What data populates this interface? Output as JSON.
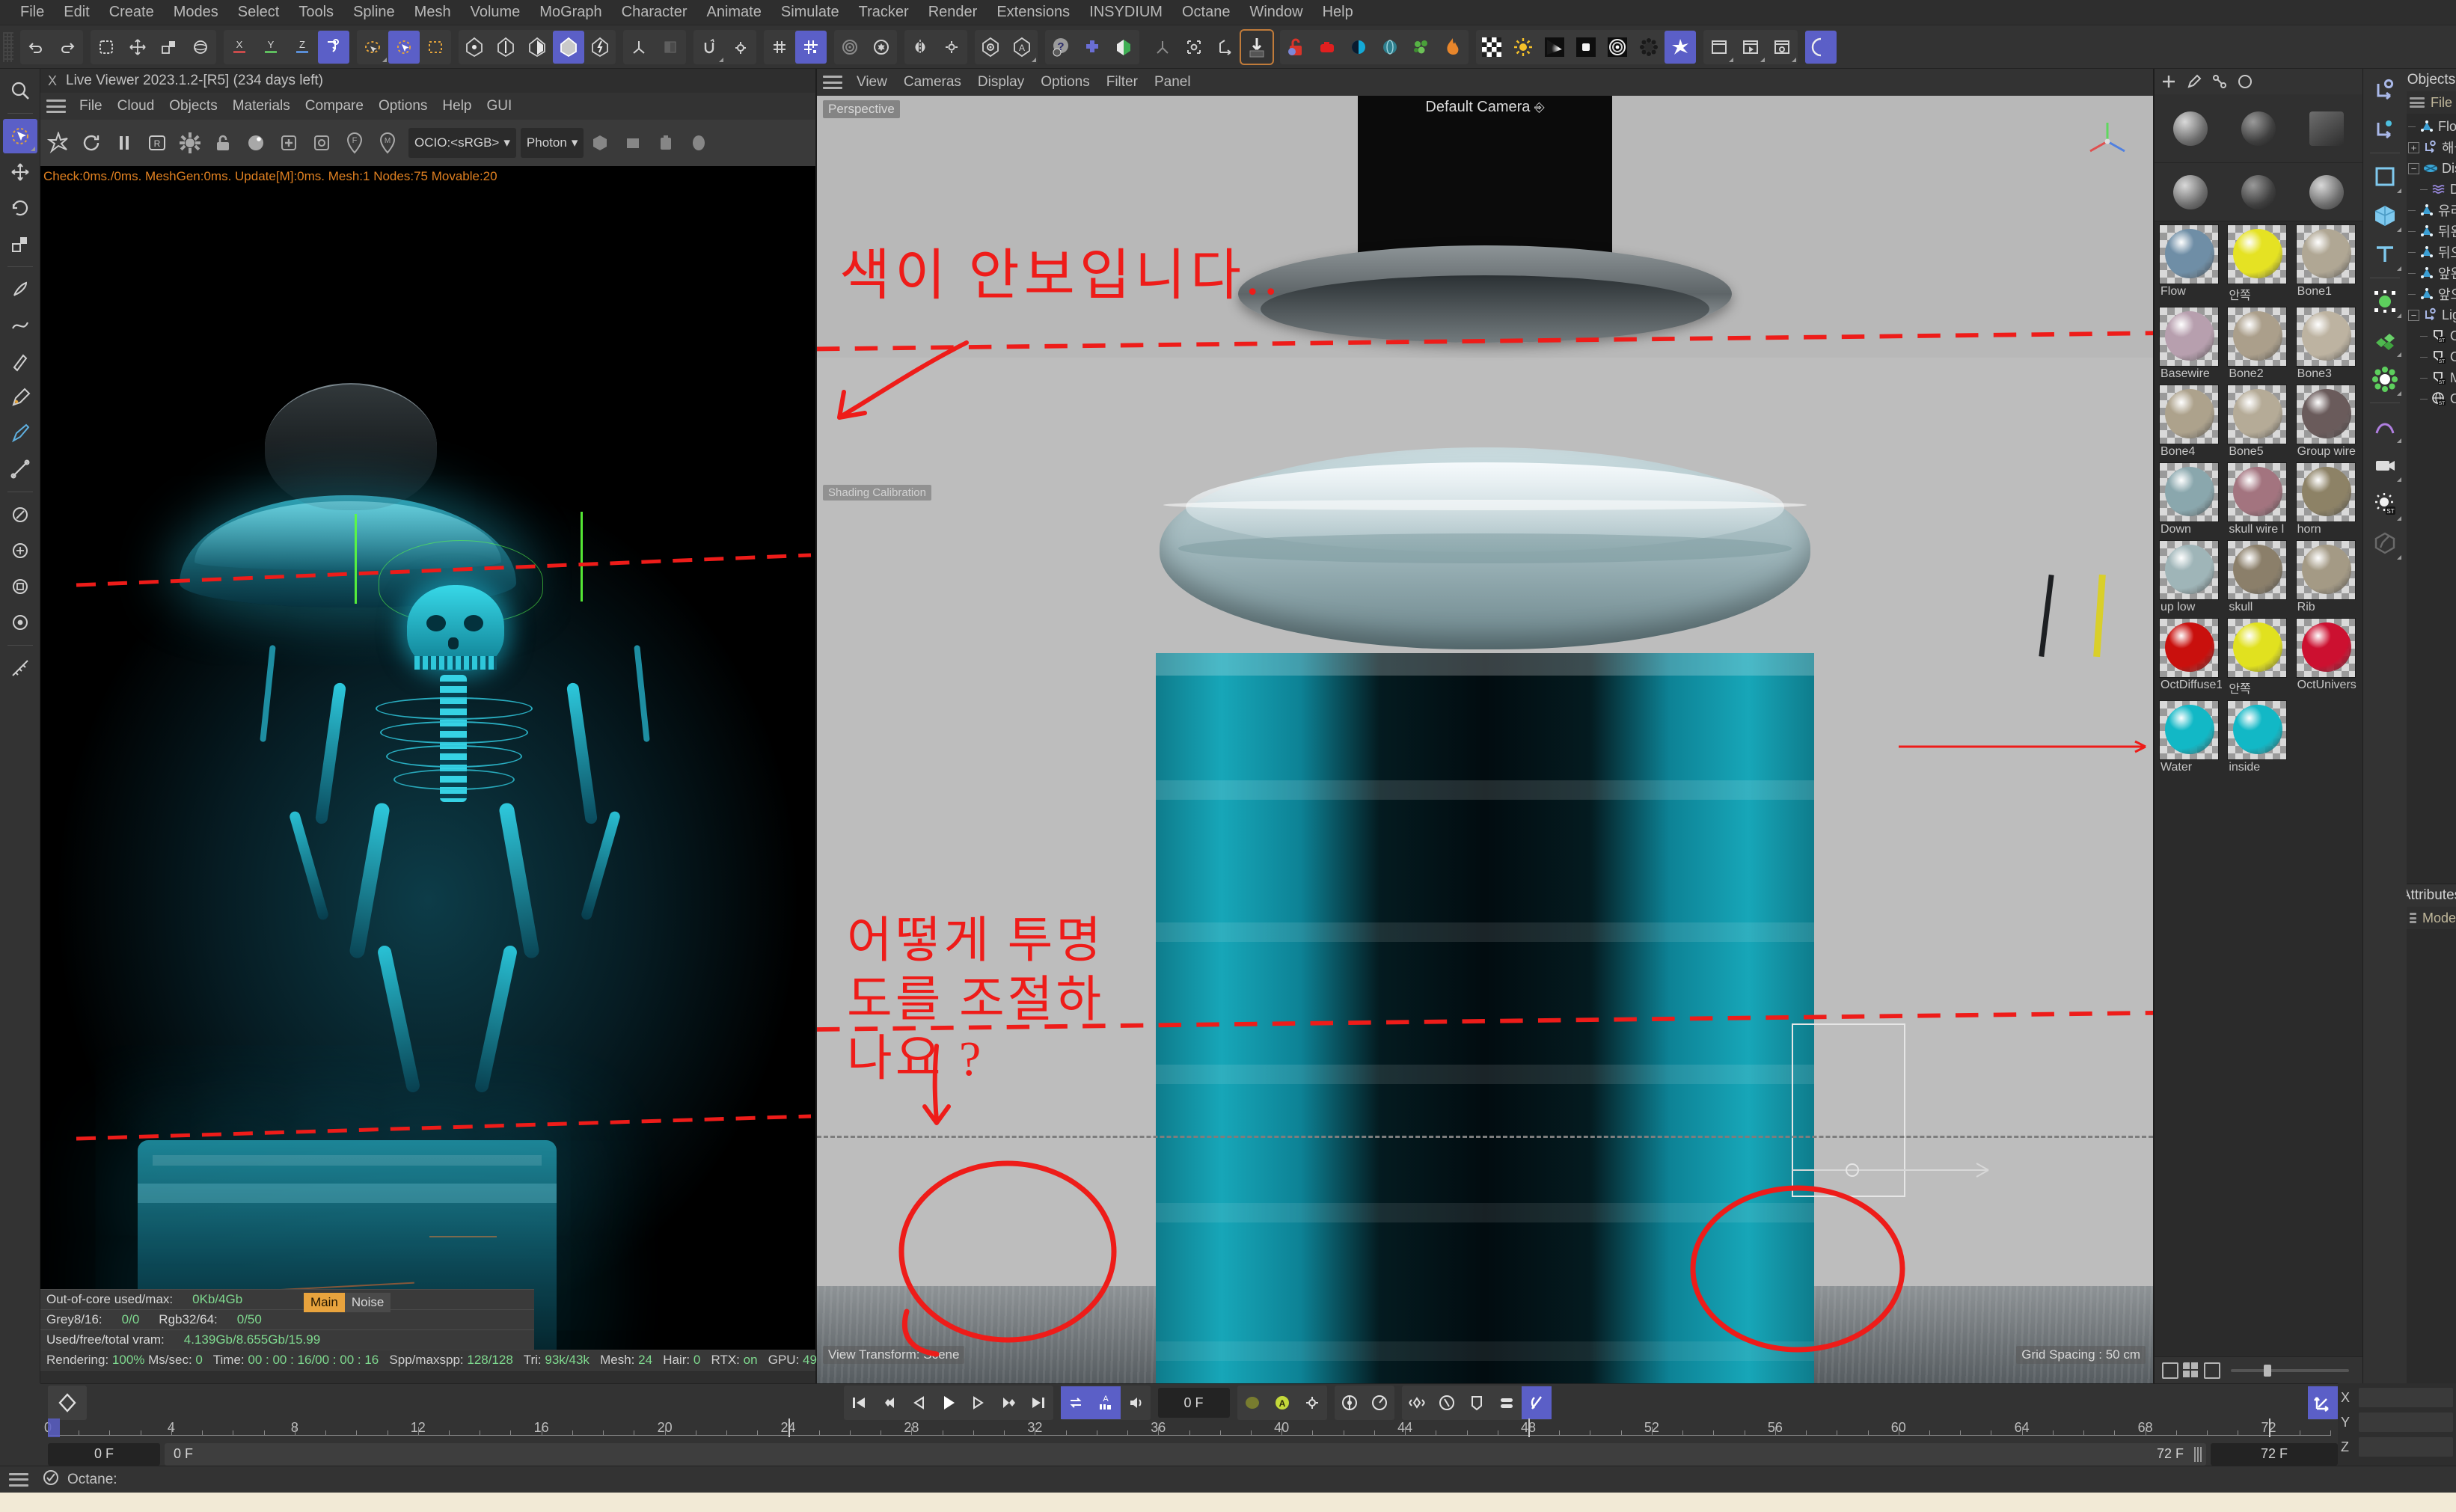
{
  "app": {
    "menu": [
      "File",
      "Edit",
      "Create",
      "Modes",
      "Select",
      "Tools",
      "Spline",
      "Mesh",
      "Volume",
      "MoGraph",
      "Character",
      "Animate",
      "Simulate",
      "Tracker",
      "Render",
      "Extensions",
      "INSYDIUM",
      "Octane",
      "Window",
      "Help"
    ]
  },
  "live_viewer": {
    "title": "Live Viewer 2023.1.2-[R5] (234 days left)",
    "close_label": "X",
    "menu": [
      "File",
      "Cloud",
      "Objects",
      "Materials",
      "Compare",
      "Options",
      "Help",
      "GUI"
    ],
    "ocio_label": "OCIO:<sRGB>",
    "photon_label": "Photon",
    "stats_overlay": "Check:0ms./0ms. MeshGen:0ms. Update[M]:0ms. Mesh:1 Nodes:75 Movable:20",
    "vram": {
      "out_of_core_label": "Out-of-core used/max:",
      "out_of_core_value": "0Kb/4Gb",
      "grey_label": "Grey8/16:",
      "grey_value": "0/0",
      "rgb_label": "Rgb32/64:",
      "rgb_value": "0/50",
      "used_label": "Used/free/total vram:",
      "used_value": "4.139Gb/8.655Gb/15.99"
    },
    "render_tags": {
      "main": "Main",
      "noise": "Noise"
    },
    "render_status": {
      "rendering_label": "Rendering:",
      "rendering_value": "100%",
      "mssec_label": "Ms/sec:",
      "mssec_value": "0",
      "time_label": "Time:",
      "time_value": "00 : 00 : 16/00 : 00 : 16",
      "spp_label": "Spp/maxspp:",
      "spp_value": "128/128",
      "tri_label": "Tri:",
      "tri_value": "93k/43k",
      "mesh_label": "Mesh:",
      "mesh_value": "24",
      "hair_label": "Hair:",
      "hair_value": "0",
      "rtx_label": "RTX:",
      "rtx_value": "on",
      "gpu_label": "GPU:",
      "gpu_value": "49"
    }
  },
  "viewport": {
    "menu": [
      "View",
      "Cameras",
      "Display",
      "Options",
      "Filter",
      "Panel"
    ],
    "perspective_label": "Perspective",
    "camera_title": "Default Camera",
    "bottom_left_label": "View Transform: Scene",
    "bottom_right_label": "Grid Spacing : 50 cm",
    "shader_label": "Shading Calibration",
    "annotations": [
      {
        "name": "color-not-visible-note",
        "text": "색이 안보입니다.."
      },
      {
        "name": "transparency-question-note",
        "text": "어떻게 투명도를 조절하나요 ?"
      }
    ]
  },
  "materials": {
    "items": [
      {
        "label": "Flow",
        "color": "#6f8ea6"
      },
      {
        "label": "안쪽",
        "color": "#e5e223"
      },
      {
        "label": "Bone1",
        "color": "#b0a794"
      },
      {
        "label": "Basewire",
        "color": "#b79fae"
      },
      {
        "label": "Bone2",
        "color": "#ab9f8b"
      },
      {
        "label": "Bone3",
        "color": "#bdb3a1"
      },
      {
        "label": "Bone4",
        "color": "#ada28c"
      },
      {
        "label": "Bone5",
        "color": "#b5ab97"
      },
      {
        "label": "Group wire",
        "color": "#6a5b5b"
      },
      {
        "label": "Down",
        "color": "#8aa7ad"
      },
      {
        "label": "skull wire l",
        "color": "#a3747f"
      },
      {
        "label": "horn",
        "color": "#8d8266"
      },
      {
        "label": "up low",
        "color": "#9fb5b8"
      },
      {
        "label": "skull",
        "color": "#8b7f6a"
      },
      {
        "label": "Rib",
        "color": "#a49a85"
      },
      {
        "label": "OctDiffuse1",
        "color": "#c9100d"
      },
      {
        "label": "안쪽",
        "color": "#e1e11f"
      },
      {
        "label": "OctUnivers",
        "color": "#cc1030"
      },
      {
        "label": "Water",
        "color": "#12b8c6"
      },
      {
        "label": "inside",
        "color": "#12b8c6"
      }
    ]
  },
  "objects_panel": {
    "tab": "Objects",
    "menu": "File",
    "tree": [
      {
        "name": "Flow",
        "icon": "polygon-icon",
        "expander": "none",
        "depth": 0
      },
      {
        "name": "해골",
        "icon": "null-icon",
        "expander": "plus",
        "depth": 0
      },
      {
        "name": "Disc",
        "icon": "disc-icon",
        "expander": "minus",
        "depth": 0
      },
      {
        "name": "D",
        "icon": "wave-icon",
        "expander": "none",
        "depth": 1
      },
      {
        "name": "유리",
        "icon": "polygon-icon",
        "expander": "none",
        "depth": 0
      },
      {
        "name": "뒤왼",
        "icon": "polygon-icon",
        "expander": "none",
        "depth": 0
      },
      {
        "name": "뒤오",
        "icon": "polygon-icon",
        "expander": "none",
        "depth": 0
      },
      {
        "name": "앞왼",
        "icon": "polygon-icon",
        "expander": "none",
        "depth": 0
      },
      {
        "name": "앞오",
        "icon": "polygon-icon",
        "expander": "none",
        "depth": 0
      },
      {
        "name": "Light",
        "icon": "null-icon",
        "expander": "minus",
        "depth": 0
      },
      {
        "name": "O",
        "icon": "arealight-icon",
        "expander": "none",
        "depth": 1
      },
      {
        "name": "O",
        "icon": "arealight-icon",
        "expander": "none",
        "depth": 1
      },
      {
        "name": "M",
        "icon": "arealight-icon",
        "expander": "none",
        "depth": 1
      },
      {
        "name": "O",
        "icon": "env-icon",
        "expander": "none",
        "depth": 1
      }
    ]
  },
  "attributes_panel": {
    "tab": "Attributes",
    "menu": "Mode"
  },
  "timeline": {
    "current_frame_field": "0 F",
    "second_frame_field": "0 F",
    "third_frame_field": "0 F",
    "range_start": "0 F",
    "range_end": "72 F",
    "preview_end": "72 F",
    "tick_labels": [
      "0",
      "4",
      "8",
      "12",
      "16",
      "20",
      "24",
      "28",
      "32",
      "36",
      "40",
      "44",
      "48",
      "52",
      "56",
      "60",
      "64",
      "68",
      "72"
    ],
    "marker_frame": 24,
    "marker2_frame": 48,
    "marker3_frame": 72,
    "min_frame": 0,
    "max_frame": 74
  },
  "coords": {
    "labels": [
      "X",
      "Y",
      "Z"
    ]
  },
  "status_bar": {
    "text": "Octane:"
  },
  "colors": {
    "accent": "#5b5fc7",
    "annotation": "#ee1c19",
    "stat_green": "#7fd98f",
    "stat_orange": "#e09a3c",
    "viewer_stats": "#e08020"
  }
}
